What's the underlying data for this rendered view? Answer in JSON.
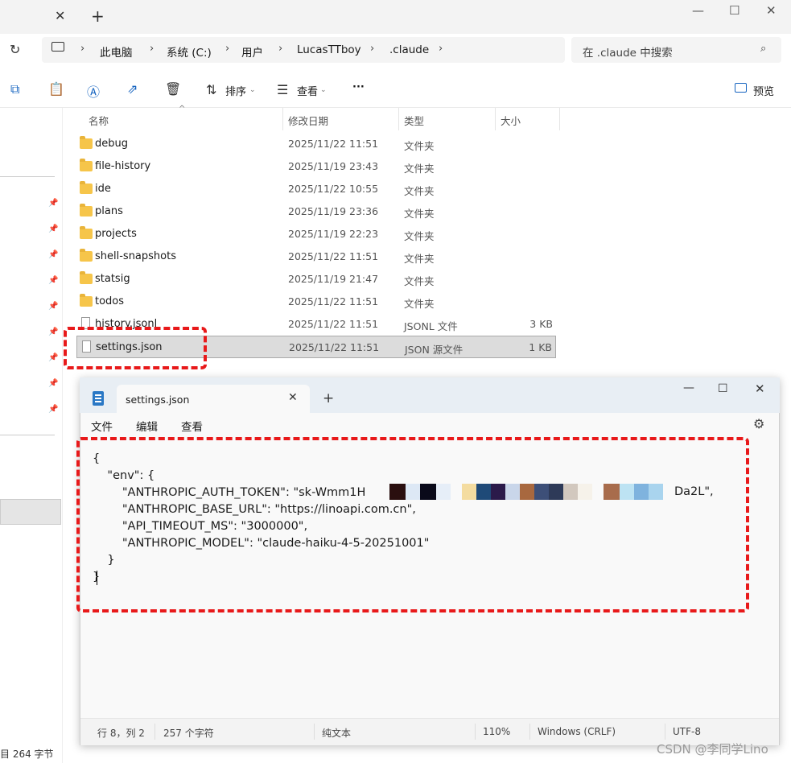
{
  "explorer": {
    "nav": {
      "refresh_icon": "↻",
      "this_pc": "此电脑",
      "drive": "系统 (C:)",
      "users": "用户",
      "user": "LucasTTboy",
      "folder": ".claude",
      "search_placeholder": "在 .claude 中搜索"
    },
    "toolbar": {
      "sort_label": "排序",
      "view_label": "查看",
      "more_label": "···",
      "preview_label": "预览"
    },
    "columns": {
      "name": "名称",
      "modified": "修改日期",
      "type": "类型",
      "size": "大小"
    },
    "files": [
      {
        "name": "debug",
        "date": "2025/11/22 11:51",
        "type": "文件夹",
        "size": "",
        "kind": "folder"
      },
      {
        "name": "file-history",
        "date": "2025/11/19 23:43",
        "type": "文件夹",
        "size": "",
        "kind": "folder"
      },
      {
        "name": "ide",
        "date": "2025/11/22 10:55",
        "type": "文件夹",
        "size": "",
        "kind": "folder"
      },
      {
        "name": "plans",
        "date": "2025/11/19 23:36",
        "type": "文件夹",
        "size": "",
        "kind": "folder"
      },
      {
        "name": "projects",
        "date": "2025/11/19 22:23",
        "type": "文件夹",
        "size": "",
        "kind": "folder"
      },
      {
        "name": "shell-snapshots",
        "date": "2025/11/22 11:51",
        "type": "文件夹",
        "size": "",
        "kind": "folder"
      },
      {
        "name": "statsig",
        "date": "2025/11/19 21:47",
        "type": "文件夹",
        "size": "",
        "kind": "folder"
      },
      {
        "name": "todos",
        "date": "2025/11/22 11:51",
        "type": "文件夹",
        "size": "",
        "kind": "folder"
      },
      {
        "name": "history.jsonl",
        "date": "2025/11/22 11:51",
        "type": "JSONL 文件",
        "size": "3 KB",
        "kind": "file"
      },
      {
        "name": "settings.json",
        "date": "2025/11/22 11:51",
        "type": "JSON 源文件",
        "size": "1 KB",
        "kind": "file"
      }
    ],
    "status": "目  264 字节"
  },
  "notepad": {
    "tab_title": "settings.json",
    "menu": {
      "file": "文件",
      "edit": "编辑",
      "view": "查看"
    },
    "lines": [
      "{",
      "    \"env\": {",
      "        \"ANTHROPIC_AUTH_TOKEN\": \"sk-Wmm1H",
      "        \"ANTHROPIC_BASE_URL\": \"https://linoapi.com.cn\",",
      "        \"API_TIMEOUT_MS\": \"3000000\",",
      "        \"ANTHROPIC_MODEL\": \"claude-haiku-4-5-20251001\"",
      "    }",
      "}"
    ],
    "token_suffix": "Da2L\",",
    "status": {
      "position": "行 8，列 2",
      "chars": "257 个字符",
      "format": "纯文本",
      "zoom": "110%",
      "line_ending": "Windows (CRLF)",
      "encoding": "UTF-8"
    }
  },
  "watermark": "CSDN @李同学Lino",
  "colors": {
    "highlight": "#e8191a",
    "folder": "#f6c54a",
    "accent": "#1664c0"
  },
  "redaction_colors": [
    "#2a0f0f",
    "#dde8f5",
    "#0a0a1a",
    "#e6eef8",
    "#f4dca0",
    "#1f4a78",
    "#2b1a4a",
    "#c9d6ea",
    "#a8683f",
    "#3d4f78",
    "#2e3a58",
    "#d2c8be",
    "#f6f2ea",
    "#a86c4c",
    "#bde3f3",
    "#7fb3de",
    "#a9d4ee"
  ]
}
